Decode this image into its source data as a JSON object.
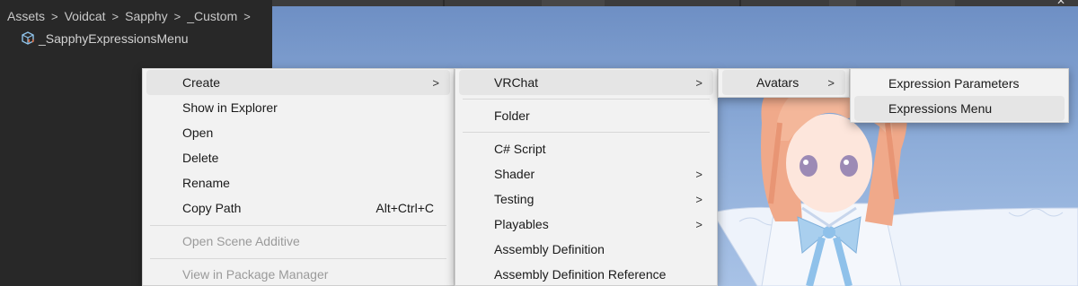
{
  "breadcrumb": [
    "Assets",
    "Voidcat",
    "Sapphy",
    "_Custom"
  ],
  "breadcrumb_separator": ">",
  "asset": {
    "name": "_SapphyExpressionsMenu",
    "icon": "scriptable-object-icon"
  },
  "menu_main": {
    "items": [
      {
        "label": "Create",
        "submenu": true,
        "highlighted": true
      },
      {
        "label": "Show in Explorer"
      },
      {
        "label": "Open"
      },
      {
        "label": "Delete"
      },
      {
        "label": "Rename"
      },
      {
        "label": "Copy Path",
        "shortcut": "Alt+Ctrl+C"
      },
      {
        "label": "Open Scene Additive",
        "disabled": true
      },
      {
        "label": "View in Package Manager",
        "disabled": true
      }
    ]
  },
  "menu_create": {
    "items": [
      {
        "label": "VRChat",
        "submenu": true,
        "highlighted": true
      },
      {
        "label": "Folder"
      },
      {
        "label": "C# Script"
      },
      {
        "label": "Shader",
        "submenu": true
      },
      {
        "label": "Testing",
        "submenu": true
      },
      {
        "label": "Playables",
        "submenu": true
      },
      {
        "label": "Assembly Definition"
      },
      {
        "label": "Assembly Definition Reference"
      }
    ]
  },
  "menu_vrchat": {
    "items": [
      {
        "label": "Avatars",
        "submenu": true,
        "highlighted": true
      }
    ]
  },
  "menu_avatars": {
    "items": [
      {
        "label": "Expression Parameters"
      },
      {
        "label": "Expressions Menu",
        "highlighted": true
      }
    ]
  },
  "submenu_arrow": ">",
  "colors": {
    "panel_bg": "#282828",
    "menu_bg": "#f2f2f2",
    "menu_highlight": "#e5e5e5",
    "sky_top": "#6e8fc4",
    "sky_bottom": "#a8c2e6",
    "hair": "#f4b79a"
  }
}
